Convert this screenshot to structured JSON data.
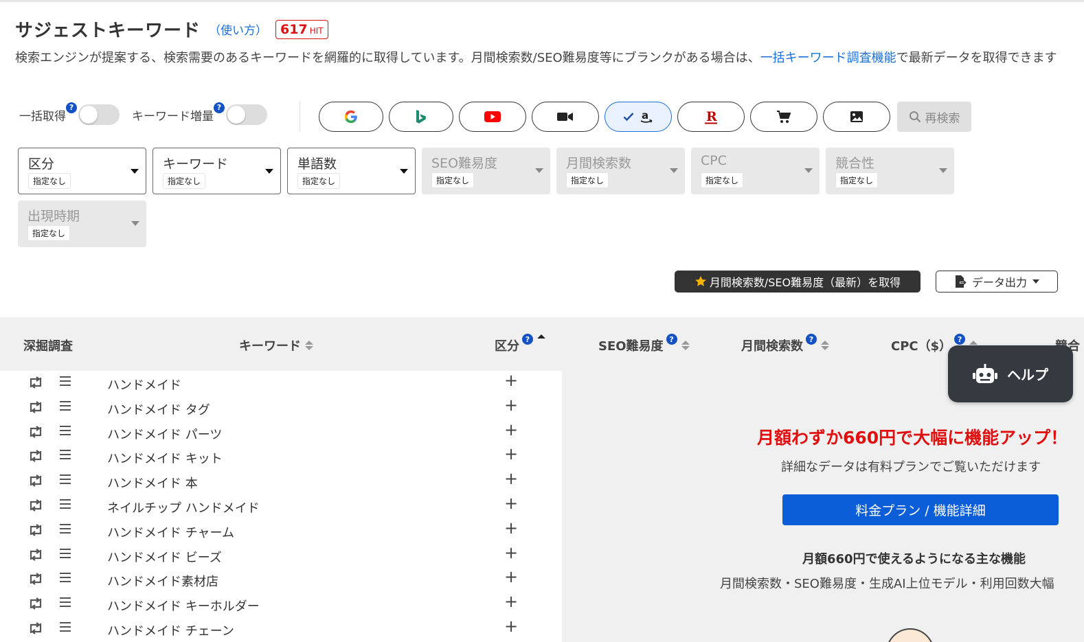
{
  "header": {
    "title": "サジェストキーワード",
    "howto": "（使い方）",
    "hit_count": "617",
    "hit_unit": "HIT"
  },
  "description": {
    "text1": "検索エンジンが提案する、検索需要のあるキーワードを網羅的に取得しています。月間検索数/SEO難易度等にブランクがある場合は、",
    "link": "一括キーワード調査機能",
    "text2": "で最新データを取得できます"
  },
  "toggles": {
    "bulk_label": "一括取得",
    "expand_label": "キーワード増量",
    "help_mark": "?"
  },
  "engines": [
    {
      "name": "google",
      "width": 94
    },
    {
      "name": "bing",
      "width": 94
    },
    {
      "name": "youtube",
      "width": 98
    },
    {
      "name": "video",
      "width": 98
    },
    {
      "name": "amazon",
      "width": 98,
      "active": true
    },
    {
      "name": "rakuten",
      "width": 98
    },
    {
      "name": "cart",
      "width": 98
    },
    {
      "name": "image",
      "width": 98
    }
  ],
  "research_label": "再検索",
  "filters": [
    {
      "label": "区分",
      "value": "指定なし",
      "disabled": false
    },
    {
      "label": "キーワード",
      "value": "指定なし",
      "disabled": false
    },
    {
      "label": "単語数",
      "value": "指定なし",
      "disabled": false
    },
    {
      "label": "SEO難易度",
      "value": "指定なし",
      "disabled": true
    },
    {
      "label": "月間検索数",
      "value": "指定なし",
      "disabled": true
    },
    {
      "label": "CPC",
      "value": "指定なし",
      "disabled": true
    },
    {
      "label": "競合性",
      "value": "指定なし",
      "disabled": true
    },
    {
      "label": "出現時期",
      "value": "指定なし",
      "disabled": true
    }
  ],
  "actions": {
    "fetch_label": "月間検索数/SEO難易度（最新）を取得",
    "export_label": "データ出力"
  },
  "table": {
    "headers": {
      "deep": "深掘調査",
      "keyword": "キーワード",
      "category": "区分",
      "seo": "SEO難易度",
      "monthly": "月間検索数",
      "cpc": "CPC（$）",
      "competition": "競合"
    },
    "rows": [
      "ハンドメイド",
      "ハンドメイド タグ",
      "ハンドメイド パーツ",
      "ハンドメイド キット",
      "ハンドメイド 本",
      "ネイルチップ ハンドメイド",
      "ハンドメイド チャーム",
      "ハンドメイド ビーズ",
      "ハンドメイド素材店",
      "ハンドメイド キーホルダー",
      "ハンドメイド チェーン"
    ],
    "plus": "+"
  },
  "promo": {
    "title": "月額わずか660円で大幅に機能アップ！",
    "subtitle": "詳細なデータは有料プランでご覧いただけます",
    "button": "料金プラン / 機能詳細",
    "features_title": "月額660円で使えるようになる主な機能",
    "features": "月間検索数・SEO難易度・生成AI上位モデル・利用回数大幅"
  },
  "help_label": "ヘルプ"
}
